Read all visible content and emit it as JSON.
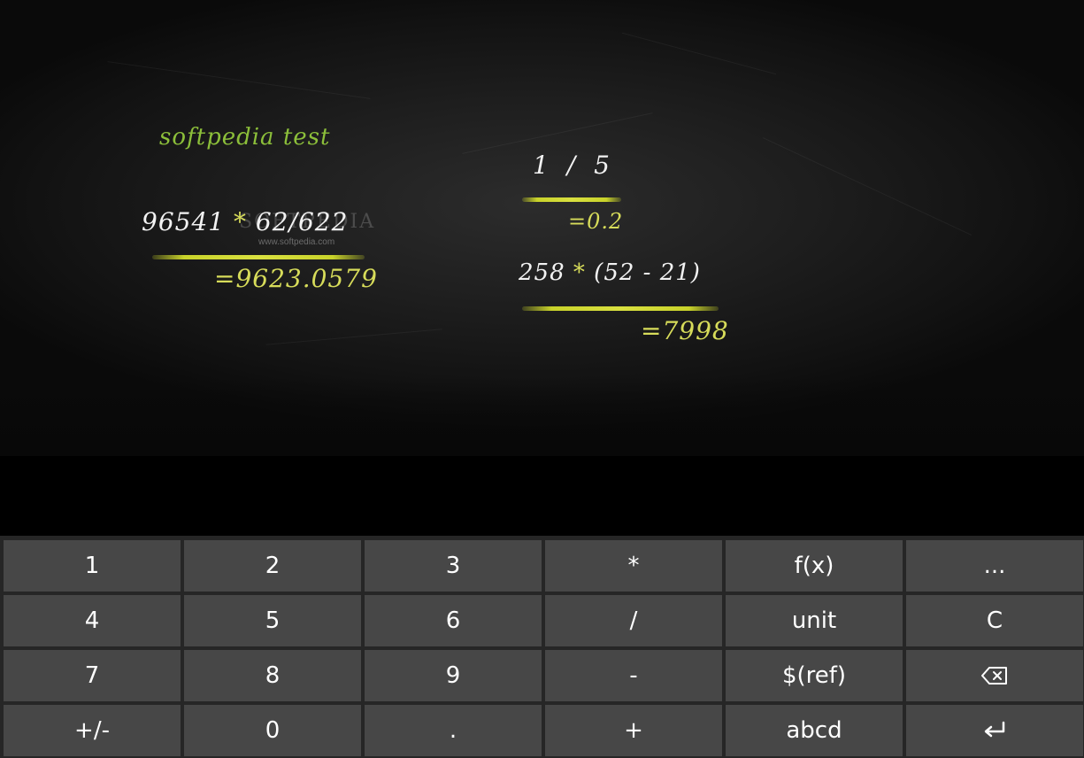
{
  "notebook": {
    "title": "softpedia test",
    "watermark": {
      "brand": "SOFTPEDIA",
      "url": "www.softpedia.com"
    },
    "calculations": [
      {
        "expr_a": "96541",
        "op1": "*",
        "expr_b": "62/622",
        "result": "=9623.0579"
      },
      {
        "expr_a": "1",
        "op1": "/",
        "expr_b": "5",
        "result": "=0.2"
      },
      {
        "expr_a": "258",
        "op1": "*",
        "expr_b": "(52 - 21)",
        "result": "=7998"
      }
    ]
  },
  "keypad": {
    "keys": [
      {
        "label": "1"
      },
      {
        "label": "2"
      },
      {
        "label": "3"
      },
      {
        "label": "*"
      },
      {
        "label": "f(x)"
      },
      {
        "label": "..."
      },
      {
        "label": "4"
      },
      {
        "label": "5"
      },
      {
        "label": "6"
      },
      {
        "label": "/"
      },
      {
        "label": "unit"
      },
      {
        "label": "C"
      },
      {
        "label": "7"
      },
      {
        "label": "8"
      },
      {
        "label": "9"
      },
      {
        "label": "-"
      },
      {
        "label": "$(ref)"
      },
      {
        "icon": "backspace-icon"
      },
      {
        "label": "+/-"
      },
      {
        "label": "0"
      },
      {
        "label": "."
      },
      {
        "label": "+"
      },
      {
        "label": "abcd"
      },
      {
        "icon": "enter-icon"
      }
    ]
  },
  "colors": {
    "chalk": "#f2f2f2",
    "result": "#d7dc5a",
    "title": "#8cbf3a",
    "key_bg": "#474747",
    "keypad_bg": "#262626"
  }
}
